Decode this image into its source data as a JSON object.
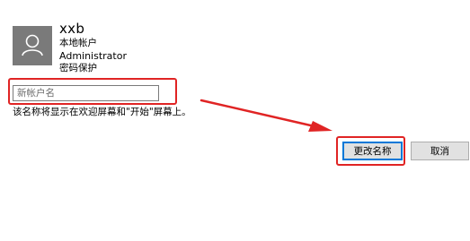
{
  "account": {
    "username": "xxb",
    "account_type": "本地帐户",
    "role": "Administrator",
    "security": "密码保护"
  },
  "rename": {
    "placeholder": "新帐户名",
    "value": "",
    "hint": "该名称将显示在欢迎屏幕和\"开始\"屏幕上。"
  },
  "buttons": {
    "rename_label": "更改名称",
    "cancel_label": "取消"
  },
  "annotation": {
    "color": "#e02424"
  }
}
